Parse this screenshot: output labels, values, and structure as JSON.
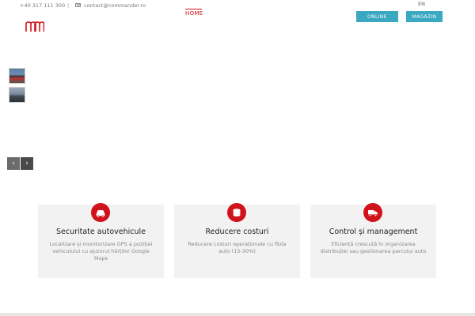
{
  "topbar": {
    "phone": "+40 317 111 300",
    "separator": "|",
    "email": "contact@commander.ro",
    "language": "EN"
  },
  "nav": {
    "home": "HOME"
  },
  "buttons": {
    "online": "ONLINE",
    "magazin": "MAGAZIN"
  },
  "slider": {
    "prev": "‹",
    "next": "›"
  },
  "features": [
    {
      "title": "Securitate autovehicule",
      "description": "Localizare și monitorizare GPS a poziției vehiculului cu ajutorul hărților Google Maps",
      "icon": "car-icon"
    },
    {
      "title": "Reducere costuri",
      "description": "Reducere costuri operaționale cu flota auto (15-30%)",
      "icon": "coins-icon"
    },
    {
      "title": "Control și management",
      "description": "Eficiență crescută în organizarea distribuției sau gestionarea parcului auto",
      "icon": "truck-icon"
    }
  ],
  "colors": {
    "brand": "#d0121b",
    "button": "#3aa8c1",
    "card_bg": "#f2f2f2"
  }
}
